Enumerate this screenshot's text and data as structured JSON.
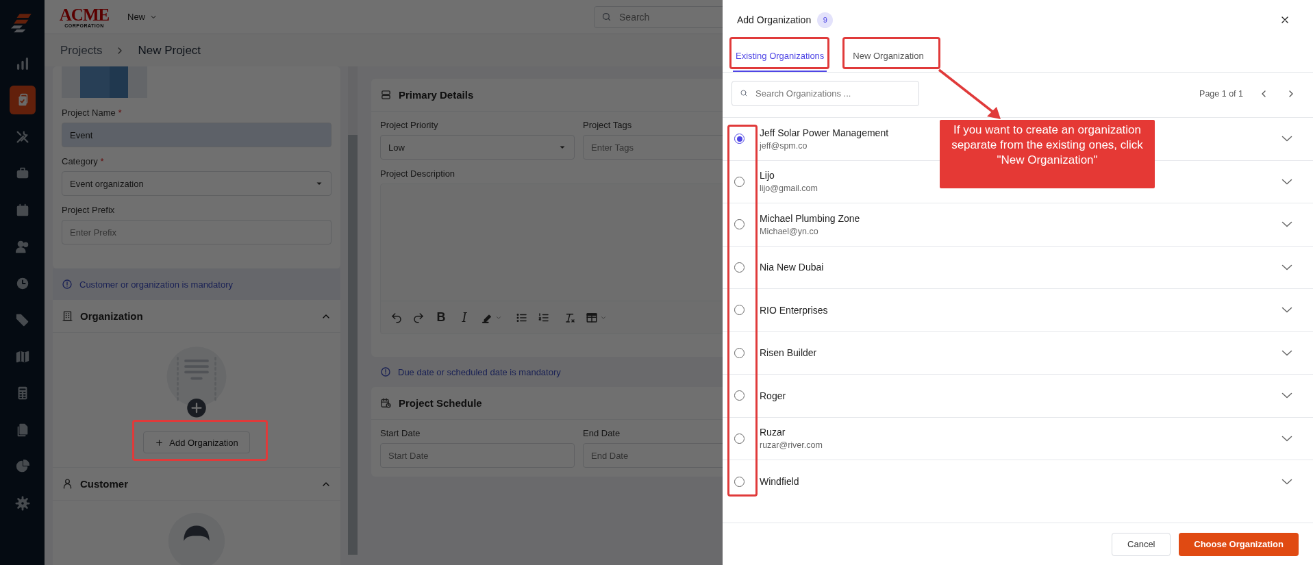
{
  "sidebar": {
    "items": [
      {
        "selected": false
      },
      {
        "selected": true
      },
      {
        "selected": false
      },
      {
        "selected": false
      },
      {
        "selected": false
      },
      {
        "selected": false
      },
      {
        "selected": false
      },
      {
        "selected": false
      },
      {
        "selected": false
      },
      {
        "selected": false
      },
      {
        "selected": false
      },
      {
        "selected": false
      },
      {
        "selected": false
      }
    ]
  },
  "header": {
    "logo": {
      "title": "ACME",
      "subtitle": "CORPORATION"
    },
    "new_menu": "New",
    "search": {
      "placeholder": "Search"
    }
  },
  "breadcrumb": [
    "Projects",
    "New Project"
  ],
  "project_form": {
    "fields": [
      {
        "label": "Project Name",
        "required_mark": "*",
        "kind": "text",
        "value": "Event"
      },
      {
        "label": "Category",
        "required_mark": "*",
        "kind": "select",
        "value": "Event organization"
      },
      {
        "label": "Project Prefix",
        "kind": "text",
        "placeholder": "Enter Prefix"
      }
    ]
  },
  "customer_notice": "Customer or organization is mandatory",
  "organization_section": {
    "title": "Organization",
    "expanded": true,
    "button": "Add Organization"
  },
  "customer_section": {
    "title": "Customer",
    "expanded": true
  },
  "primary_details": {
    "title": "Primary Details",
    "fields": [
      {
        "label": "Project Priority",
        "kind": "select",
        "value": "Low"
      },
      {
        "label": "Project Tags",
        "kind": "text",
        "placeholder": "Enter Tags"
      }
    ],
    "description_label": "Project Description",
    "toolbar": [
      {
        "kind": "undo"
      },
      {
        "kind": "redo"
      },
      {
        "kind": "bold",
        "label": "B"
      },
      {
        "kind": "italic",
        "label": "I"
      },
      {
        "kind": "highlight"
      },
      {
        "kind": "bullets"
      },
      {
        "kind": "numbers"
      },
      {
        "kind": "clear"
      },
      {
        "kind": "table"
      }
    ]
  },
  "schedule_notice": "Due date or scheduled date is mandatory",
  "project_schedule": {
    "title": "Project Schedule",
    "fields": [
      {
        "label": "Start Date",
        "placeholder": "Start Date"
      },
      {
        "label": "End Date",
        "placeholder": "End Date"
      }
    ]
  },
  "drawer": {
    "title": "Add Organization",
    "count": "9",
    "tabs": [
      {
        "label": "Existing Organizations",
        "selected": true
      },
      {
        "label": "New Organization",
        "selected": false
      }
    ],
    "search": {
      "placeholder": "Search Organizations ..."
    },
    "pagination": "Page 1 of 1",
    "organizations": [
      {
        "name": "Jeff Solar Power Management",
        "email": "jeff@spm.co",
        "selected": true
      },
      {
        "name": "Lijo",
        "email": "lijo@gmail.com",
        "selected": false
      },
      {
        "name": "Michael Plumbing Zone",
        "email": "Michael@yn.co",
        "selected": false
      },
      {
        "name": "Nia New Dubai",
        "selected": false
      },
      {
        "name": "RIO Enterprises",
        "selected": false
      },
      {
        "name": "Risen Builder",
        "selected": false
      },
      {
        "name": "Roger",
        "selected": false
      },
      {
        "name": "Ruzar",
        "email": "ruzar@river.com",
        "selected": false
      },
      {
        "name": "Windfield",
        "selected": false
      }
    ],
    "buttons": {
      "cancel": "Cancel",
      "confirm": "Choose Organization"
    }
  },
  "annotation": {
    "text": "If you want to create an organization separate from the existing ones, click \"New Organization\""
  }
}
